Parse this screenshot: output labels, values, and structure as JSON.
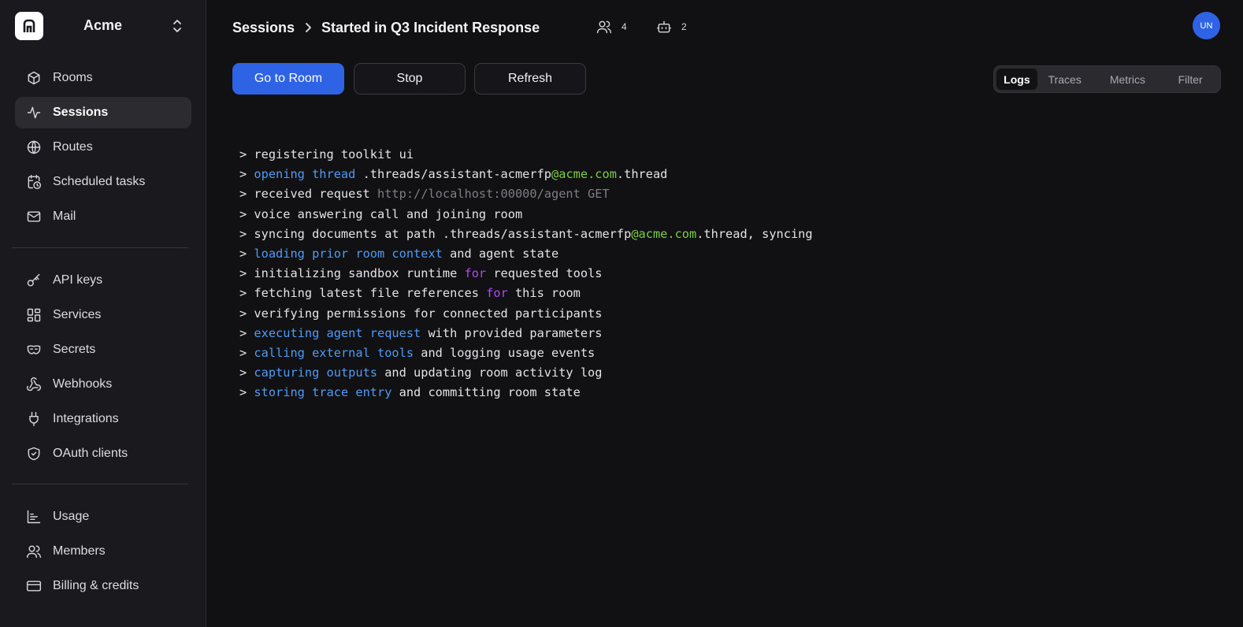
{
  "app": {
    "org_name": "Acme",
    "accent": "#2f63e6"
  },
  "sidebar": {
    "groups": [
      [
        {
          "label": "Rooms",
          "icon": "cube-icon"
        },
        {
          "label": "Sessions",
          "icon": "activity-icon",
          "active": true
        },
        {
          "label": "Routes",
          "icon": "globe-icon"
        },
        {
          "label": "Scheduled tasks",
          "icon": "calendar-clock-icon"
        },
        {
          "label": "Mail",
          "icon": "mail-icon"
        }
      ],
      [
        {
          "label": "API keys",
          "icon": "key-icon"
        },
        {
          "label": "Services",
          "icon": "grid-icon"
        },
        {
          "label": "Secrets",
          "icon": "mask-icon"
        },
        {
          "label": "Webhooks",
          "icon": "webhook-icon"
        },
        {
          "label": "Integrations",
          "icon": "plug-icon"
        },
        {
          "label": "OAuth clients",
          "icon": "shield-icon"
        }
      ],
      [
        {
          "label": "Usage",
          "icon": "bar-chart-icon"
        },
        {
          "label": "Members",
          "icon": "users-icon"
        },
        {
          "label": "Billing & credits",
          "icon": "credit-card-icon"
        }
      ]
    ]
  },
  "header": {
    "breadcrumb_root": "Sessions",
    "breadcrumb_current": "Started in Q3 Incident Response",
    "participants_count": "4",
    "agents_count": "2",
    "avatar_initials": "UN"
  },
  "toolbar": {
    "go_to_room_label": "Go to Room",
    "stop_label": "Stop",
    "refresh_label": "Refresh"
  },
  "tabs": [
    {
      "label": "Logs",
      "active": true
    },
    {
      "label": "Traces"
    },
    {
      "label": "Metrics"
    },
    {
      "label": "Filter"
    }
  ],
  "log_lines": [
    [
      {
        "t": "> registering toolkit ui"
      }
    ],
    [
      {
        "t": "> "
      },
      {
        "t": "opening thread",
        "c": "b"
      },
      {
        "t": " .threads/assistant-acmerfp"
      },
      {
        "t": "@acme.com",
        "c": "g"
      },
      {
        "t": ".thread"
      }
    ],
    [
      {
        "t": "> received request "
      },
      {
        "t": "http://localhost:00000/agent GET",
        "c": "d"
      }
    ],
    [
      {
        "t": "> voice answering call and joining room"
      }
    ],
    [
      {
        "t": "> syncing documents at path .threads/assistant-acmerfp"
      },
      {
        "t": "@acme.com",
        "c": "g"
      },
      {
        "t": ".thread, syncing"
      }
    ],
    [
      {
        "t": "> "
      },
      {
        "t": "loading prior room context",
        "c": "b"
      },
      {
        "t": " and agent state"
      }
    ],
    [
      {
        "t": "> initializing sandbox runtime "
      },
      {
        "t": "for",
        "c": "m"
      },
      {
        "t": " requested tools"
      }
    ],
    [
      {
        "t": "> fetching latest file references "
      },
      {
        "t": "for",
        "c": "m"
      },
      {
        "t": " this room"
      }
    ],
    [
      {
        "t": "> verifying permissions for connected participants"
      }
    ],
    [
      {
        "t": "> "
      },
      {
        "t": "executing agent request",
        "c": "b"
      },
      {
        "t": " with provided parameters"
      }
    ],
    [
      {
        "t": "> "
      },
      {
        "t": "calling external tools",
        "c": "b"
      },
      {
        "t": " and logging usage events"
      }
    ],
    [
      {
        "t": "> "
      },
      {
        "t": "capturing outputs",
        "c": "b"
      },
      {
        "t": " and updating room activity log"
      }
    ],
    [
      {
        "t": "> "
      },
      {
        "t": "storing trace entry",
        "c": "b"
      },
      {
        "t": " and committing room state"
      }
    ]
  ]
}
